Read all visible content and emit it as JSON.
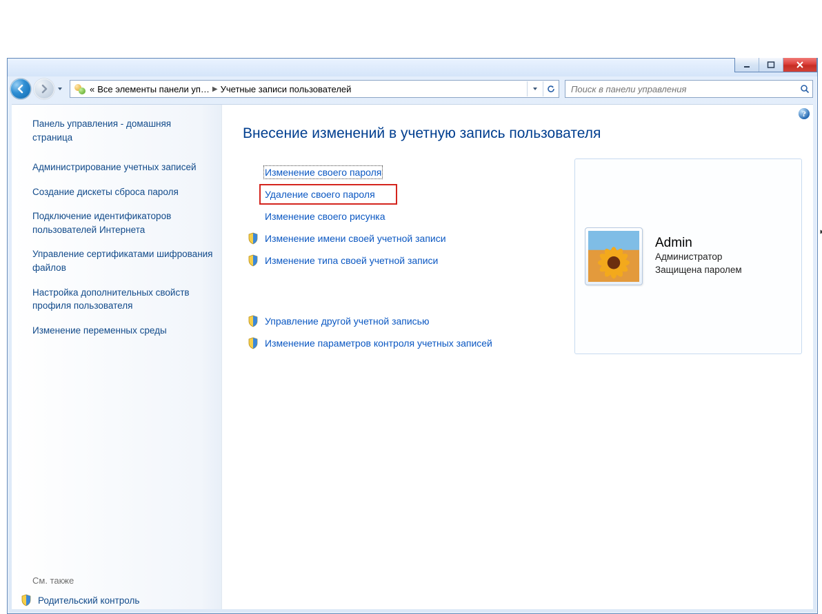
{
  "titlebar": {
    "window_controls": {
      "minimize": "minimize",
      "maximize": "maximize",
      "close": "close"
    }
  },
  "addressbar": {
    "crumb_prefix": "«",
    "crumb1": "Все элементы панели уп…",
    "crumb2": "Учетные записи пользователей",
    "refresh_label": "refresh"
  },
  "search": {
    "placeholder": "Поиск в панели управления"
  },
  "sidebar": {
    "home": "Панель управления - домашняя страница",
    "tasks": [
      "Администрирование учетных записей",
      "Создание дискеты сброса пароля",
      "Подключение идентификаторов пользователей Интернета",
      "Управление сертификатами шифрования файлов",
      "Настройка дополнительных свойств профиля пользователя",
      "Изменение переменных среды"
    ],
    "see_also": "См. также",
    "parental": "Родительский контроль"
  },
  "main": {
    "heading": "Внесение изменений в учетную запись пользователя",
    "actions": {
      "change_password": "Изменение своего пароля",
      "remove_password": "Удаление своего пароля",
      "change_picture": "Изменение своего рисунка",
      "change_name": "Изменение имени своей учетной записи",
      "change_type": "Изменение типа своей учетной записи",
      "manage_other": "Управление другой учетной записью",
      "change_uac": "Изменение параметров контроля учетных записей"
    },
    "user": {
      "name": "Admin",
      "role": "Администратор",
      "protected": "Защищена паролем"
    }
  }
}
